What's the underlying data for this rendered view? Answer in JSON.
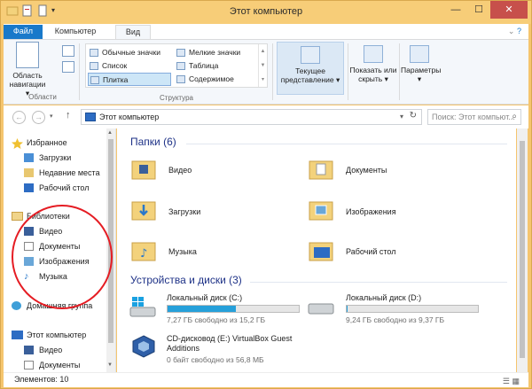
{
  "window": {
    "title": "Этот компьютер"
  },
  "tabs": {
    "file": "Файл",
    "computer": "Компьютер",
    "view": "Вид"
  },
  "ribbon": {
    "nav_area_label": "Область навигации",
    "nav_area_arrow": "▾",
    "group_panes": "Области",
    "group_layout": "Структура",
    "layouts": [
      "Обычные значки",
      "Мелкие значки",
      "Список",
      "Таблица",
      "Плитка",
      "Содержимое"
    ],
    "current_view": "Текущее представление",
    "show_hide": "Показать или скрыть",
    "options": "Параметры"
  },
  "nav": {
    "address": "Этот компьютер",
    "search_placeholder": "Поиск: Этот компьют..."
  },
  "navpane": {
    "favorites": "Избранное",
    "downloads": "Загрузки",
    "recent": "Недавние места",
    "desktop": "Рабочий стол",
    "libraries": "Библиотеки",
    "lib_video": "Видео",
    "lib_docs": "Документы",
    "lib_images": "Изображения",
    "lib_music": "Музыка",
    "homegroup": "Домашняя группа",
    "thispc": "Этот компьютер",
    "pc_video": "Видео",
    "pc_docs": "Документы"
  },
  "content": {
    "folders_header": "Папки (6)",
    "folders": [
      "Видео",
      "Документы",
      "Загрузки",
      "Изображения",
      "Музыка",
      "Рабочий стол"
    ],
    "devices_header": "Устройства и диски (3)",
    "drives": [
      {
        "name": "Локальный диск (C:)",
        "info": "7,27 ГБ свободно из 15,2 ГБ",
        "used_fraction": 0.52
      },
      {
        "name": "Локальный диск (D:)",
        "info": "9,24 ГБ свободно из 9,37 ГБ",
        "used_fraction": 0.01
      }
    ],
    "cd": {
      "name": "CD-дисковод (E:) VirtualBox Guest Additions",
      "info": "0 байт свободно из 56,8 МБ"
    }
  },
  "status": {
    "items": "Элементов: 10"
  },
  "colors": {
    "accent": "#1979ca",
    "window_frame": "#f5c56e",
    "header_text": "#1e3287",
    "annotation": "#e51c23"
  }
}
